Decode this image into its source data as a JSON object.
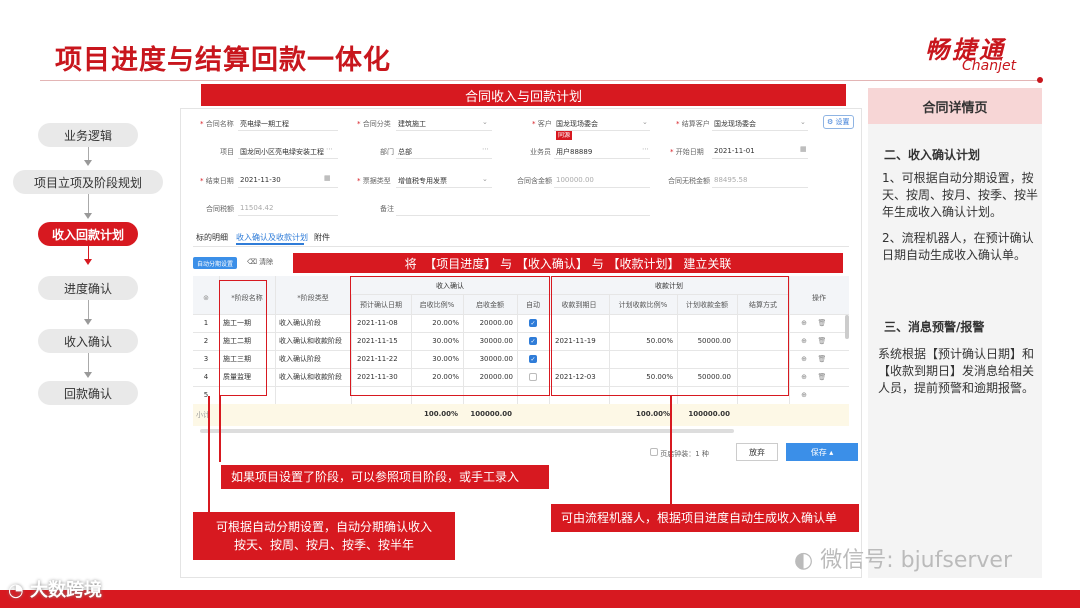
{
  "header": {
    "title": "项目进度与结算回款一体化",
    "brand_cn": "畅捷通",
    "brand_en": "Chanjet"
  },
  "flow": {
    "steps": [
      "业务逻辑",
      "项目立项及阶段规划",
      "收入回款计划",
      "进度确认",
      "收入确认",
      "回款确认"
    ],
    "active_index": 2
  },
  "banner_top": "合同收入与回款计划",
  "banner_mid": "将  【项目进度】 与 【收入确认】 与 【收款计划】 建立关联",
  "form": {
    "contract_name_label": "合同名称",
    "contract_name": "亮电绿一期工程",
    "contract_type_label": "合同分类",
    "contract_type": "建筑施工",
    "customer_label": "客户",
    "customer": "国龙现场委会",
    "customer_tag": "同源",
    "settle_customer_label": "结算客户",
    "settle_customer": "国龙现场委会",
    "settings_btn": "设置",
    "project_label": "项目",
    "project": "国龙同小区亮电绿安装工程",
    "dept_label": "部门",
    "dept": "总部",
    "salesman_label": "业务员",
    "salesman": "用户88889",
    "start_date_label": "开始日期",
    "start_date": "2021-11-01",
    "end_date_label": "结束日期",
    "end_date": "2021-11-30",
    "invoice_type_label": "票据类型",
    "invoice_type": "增值税专用发票",
    "amount_label": "合同含金额",
    "amount": "100000.00",
    "amount_no_tax_label": "合同无税金额",
    "amount_no_tax": "88495.58",
    "tax_label": "合同税额",
    "tax": "11504.42",
    "remark_label": "备注",
    "tabs": [
      "标的明细",
      "收入确认及收款计划",
      "附件"
    ],
    "btn_auto": "自动分期设置",
    "btn_clear": "清除"
  },
  "table": {
    "group_income": "收入确认",
    "group_receipt": "收款计划",
    "headers": [
      "",
      "*阶段名称",
      "*阶段类型",
      "预计确认日期",
      "启收比例%",
      "启收金额",
      "自动",
      "收款到期日",
      "计划收款比例%",
      "计划收款金额",
      "结算方式",
      "操作"
    ],
    "rows": [
      {
        "no": "1",
        "stage": "施工一期",
        "type": "收入确认阶段",
        "date": "2021-11-08",
        "ratio": "20.00%",
        "amt": "20000.00",
        "auto": true,
        "due": "",
        "pratio": "",
        "pamt": ""
      },
      {
        "no": "2",
        "stage": "施工二期",
        "type": "收入确认和收款阶段",
        "date": "2021-11-15",
        "ratio": "30.00%",
        "amt": "30000.00",
        "auto": true,
        "due": "2021-11-19",
        "pratio": "50.00%",
        "pamt": "50000.00"
      },
      {
        "no": "3",
        "stage": "施工三期",
        "type": "收入确认阶段",
        "date": "2021-11-22",
        "ratio": "30.00%",
        "amt": "30000.00",
        "auto": true,
        "due": "",
        "pratio": "",
        "pamt": ""
      },
      {
        "no": "4",
        "stage": "质量监理",
        "type": "收入确认和收款阶段",
        "date": "2021-11-30",
        "ratio": "20.00%",
        "amt": "20000.00",
        "auto": false,
        "due": "2021-12-03",
        "pratio": "50.00%",
        "pamt": "50000.00"
      },
      {
        "no": "5",
        "stage": "",
        "type": "",
        "date": "",
        "ratio": "",
        "amt": "",
        "auto": null,
        "due": "",
        "pratio": "",
        "pamt": ""
      }
    ],
    "subtotal_label": "小计",
    "subtotal_ratio": "100.00%",
    "subtotal_amt": "100000.00",
    "subtotal_pratio": "100.00%",
    "subtotal_pamt": "100000.00",
    "footer_count": "页启钟装：1 种",
    "btn_discard": "放弃",
    "btn_save": "保存 ▴"
  },
  "notes": {
    "n1": "如果项目设置了阶段，可以参照项目阶段，或手工录入",
    "n2_line1": "可根据自动分期设置，自动分期确认收入",
    "n2_line2": "按天、按周、按月、按季、按半年",
    "n3": "可由流程机器人，根据项目进度自动生成收入确认单"
  },
  "right_panel": {
    "head": "合同详情页",
    "s2_title": "二、收入确认计划",
    "s2_p1": "1、可根据自动分期设置，按天、按周、按月、按季、按半年生成收入确认计划。",
    "s2_p2": "2、流程机器人，在预计确认日期自动生成收入确认单。",
    "s3_title": "三、消息预警/报警",
    "s3_p": "系统根据【预计确认日期】和【收款到期日】发消息给相关人员，提前预警和逾期报警。"
  },
  "watermark": {
    "wechat": "微信号: bjufserver",
    "corner": "大数跨境"
  },
  "colors": {
    "accent": "#d71920",
    "brand": "#c8161d",
    "panel_head": "#f7d6d6",
    "save_btn": "#3b8fe8"
  }
}
